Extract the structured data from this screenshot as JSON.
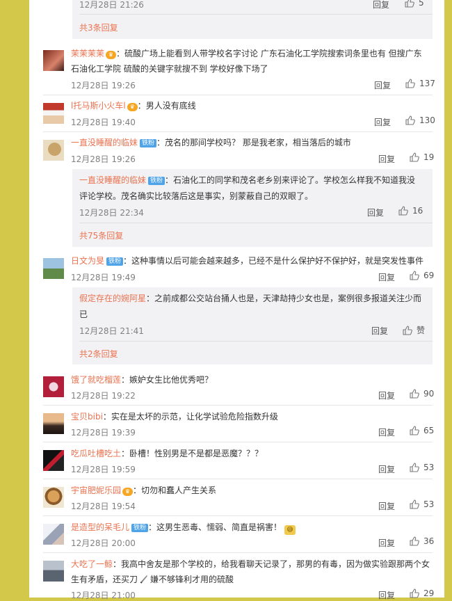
{
  "common": {
    "reply_label": "回复",
    "more_suffix": "回复",
    "colon": "："
  },
  "top_reply": {
    "time": "12月28日 21:26",
    "likes": "5",
    "more": "共3条回复"
  },
  "comments": [
    {
      "user": "茉茉茉茉",
      "badge": "",
      "text": "硫酸广场上能看到人带学校名字讨论 广东石油化工学院搜索词条里也有 但搜广东",
      "text2": "石油化工学院 硫酸的关键字就搜不到 学校好像下场了",
      "time": "12月28日 19:26",
      "likes": "137"
    },
    {
      "user": "l托马斯小火车l",
      "badge": "",
      "text": "男人没有底线",
      "text2": "",
      "time": "12月28日 19:40",
      "likes": "130"
    },
    {
      "user": "一直没睡醒的临妹",
      "badge": "铁粉",
      "text": "茂名的那间学校吗？ 那是我老家，相当落后的城市",
      "text2": "",
      "time": "12月28日 19:26",
      "likes": "19"
    },
    {
      "user": "日文为旻",
      "badge": "铁粉",
      "text": "这种事情以后可能会越来越多，已经不是什么保护好不保护好，就是突发性事件",
      "text2": "",
      "time": "12月28日 19:49",
      "likes": "69"
    },
    {
      "user": "饿了就吃榴莲",
      "badge": "",
      "text": "嫉妒女生比他优秀吧？",
      "text2": "",
      "time": "12月28日 19:22",
      "likes": "90"
    },
    {
      "user": "宝贝bibi",
      "badge": "",
      "text": "实在是太坏的示范，让化学试验危险指数升级",
      "text2": "",
      "time": "12月28日 19:39",
      "likes": "65"
    },
    {
      "user": "吃瓜吐槽吃土",
      "badge": "",
      "text": "卧槽！性别男是不是都是恶魔？？？",
      "text2": "",
      "time": "12月28日 19:59",
      "likes": "53"
    },
    {
      "user": "宇宙肥妮乐园",
      "badge": "",
      "text": "切勿和蠢人产生关系",
      "text2": "",
      "time": "12月28日 19:54",
      "likes": "53"
    },
    {
      "user": "是造型的呆毛儿",
      "badge": "铁粉",
      "text": "这男生恶毒、懦弱、简直是祸害！",
      "text2": "",
      "time": "12月28日 20:00",
      "likes": "36"
    },
    {
      "user": "大吃了一鲸",
      "badge": "",
      "text": "我高中舍友是那个学校的，给我看聊天记录了，那男的有毒，因为做实验跟那两个女",
      "text2": "生有矛盾，还买刀",
      "text2b": "嫌不够锋利才用的硫酸",
      "time": "12月28日 21:00",
      "likes": "29"
    }
  ],
  "replies": [
    {
      "user": "一直没睡醒的临妹",
      "badge": "铁粉",
      "text": "石油化工的同学和茂名老乡别来评论了。学校怎么样我不知道我没",
      "text2": "评论学校。茂名确实比较落后这是事实，别蒙蔽自己的双眼了。",
      "time": "12月28日 22:34",
      "likes": "16",
      "more": "共75条回复"
    },
    {
      "user": "假定存在的婉阿星",
      "badge": "",
      "text": "之前成都公交站台捅人也是，天津劫持少女也是，案例很多报道关注少而",
      "text2": "已",
      "time": "12月28日 21:41",
      "likes": "赞",
      "more": "共2条回复"
    }
  ],
  "colors": {
    "accent": "#eb7350",
    "page_bg": "#d4c84a",
    "reply_bg": "#f2f2f5",
    "badge": "#4fa3e8"
  },
  "icons": [
    "thumb-up-icon",
    "vip-crown-icon",
    "knife-icon",
    "sweat-emoji-icon"
  ]
}
